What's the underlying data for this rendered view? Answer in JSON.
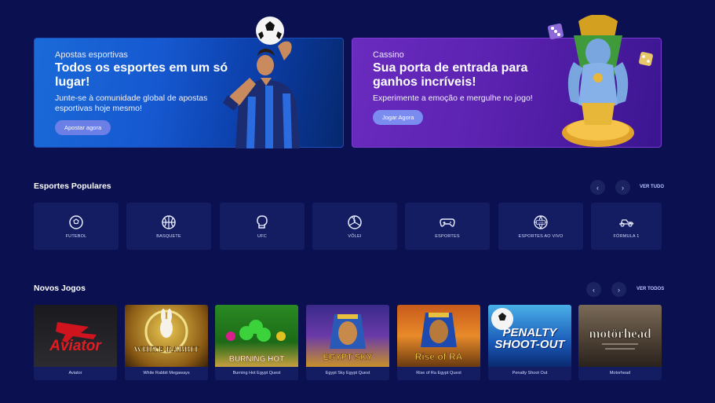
{
  "banners": {
    "sports": {
      "category": "Apostas esportivas",
      "title": "Todos os esportes em um só lugar!",
      "description": "Junte-se à comunidade global de apostas esportivas hoje mesmo!",
      "button": "Apostar agora"
    },
    "casino": {
      "category": "Cassino",
      "title": "Sua porta de entrada para ganhos incríveis!",
      "description": "Experimente a emoção e mergulhe no jogo!",
      "button": "Jogar Agora"
    }
  },
  "popular_sports": {
    "title": "Esportes Populares",
    "see_all": "VER TUDO",
    "items": [
      {
        "label": "FUTEBOL",
        "icon": "soccer-ball-icon"
      },
      {
        "label": "BASQUETE",
        "icon": "basketball-icon"
      },
      {
        "label": "UFC",
        "icon": "boxing-glove-icon"
      },
      {
        "label": "VÔLEI",
        "icon": "volleyball-icon"
      },
      {
        "label": "ESPORTES",
        "icon": "gamepad-icon"
      },
      {
        "label": "ESPORTES AO VIVO",
        "icon": "live-globe-icon"
      },
      {
        "label": "FÓRMULA 1",
        "icon": "f1-car-icon"
      }
    ]
  },
  "new_games": {
    "title": "Novos Jogos",
    "see_all": "VER TODOS",
    "items": [
      {
        "label": "Aviator",
        "art_text": "Aviator"
      },
      {
        "label": "White Rabbit Megaways",
        "art_text": "WHITE RABBIT"
      },
      {
        "label": "Burning Hot Egypt Quest",
        "art_text": "BURNING HOT"
      },
      {
        "label": "Egypt Sky Egypt Quest",
        "art_text": "EGYPT SKY"
      },
      {
        "label": "Rise of Ra Egypt Quest",
        "art_text": "Rise of RA"
      },
      {
        "label": "Penalty Shoot Out",
        "art_text": "PENALTY SHOOT-OUT"
      },
      {
        "label": "Motorhead",
        "art_text": "motörhead"
      }
    ]
  },
  "colors": {
    "background": "#0b1150",
    "tile": "#141d62",
    "accent_button": "#6b7fe6"
  }
}
